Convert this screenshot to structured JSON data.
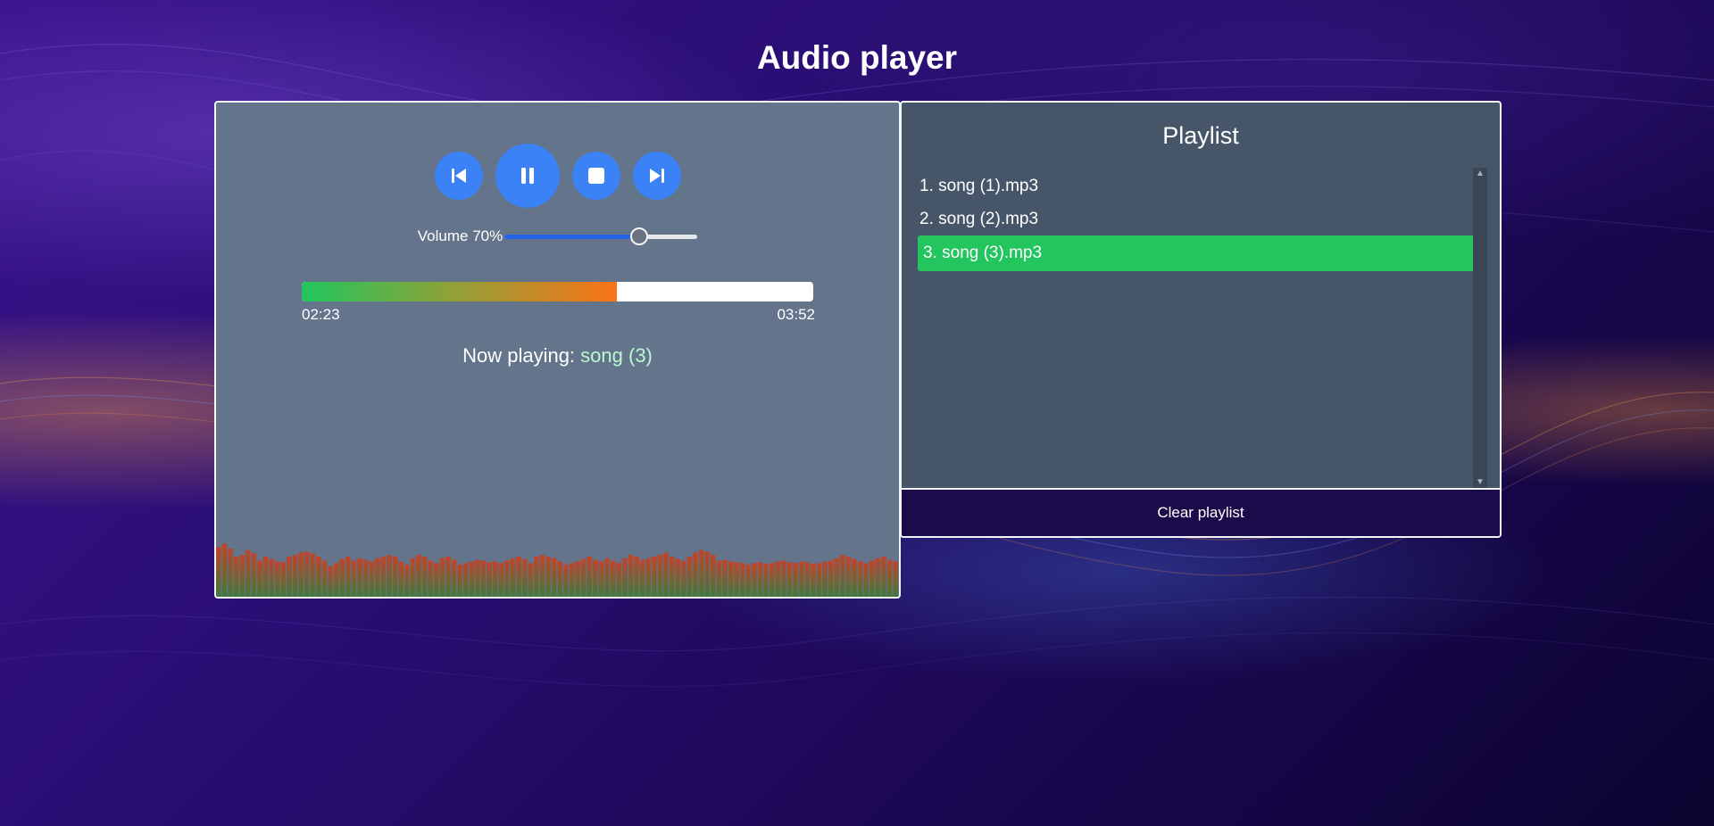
{
  "app": {
    "title": "Audio player"
  },
  "controls": {
    "previous_icon": "skip-previous-icon",
    "pause_icon": "pause-icon",
    "stop_icon": "stop-icon",
    "next_icon": "skip-next-icon",
    "accent_color": "#3b82f6"
  },
  "volume": {
    "label": "Volume 70%",
    "value": 70
  },
  "progress": {
    "current": "02:23",
    "duration": "03:52",
    "fraction": 0.616
  },
  "now_playing": {
    "prefix": "Now playing:",
    "song": "song (3)"
  },
  "visualizer": {
    "levels": [
      0.62,
      0.66,
      0.6,
      0.5,
      0.52,
      0.58,
      0.54,
      0.45,
      0.5,
      0.47,
      0.44,
      0.43,
      0.5,
      0.52,
      0.55,
      0.56,
      0.54,
      0.5,
      0.45,
      0.38,
      0.42,
      0.47,
      0.5,
      0.45,
      0.48,
      0.46,
      0.44,
      0.48,
      0.5,
      0.52,
      0.5,
      0.44,
      0.4,
      0.48,
      0.52,
      0.5,
      0.45,
      0.42,
      0.48,
      0.5,
      0.46,
      0.4,
      0.42,
      0.44,
      0.46,
      0.45,
      0.43,
      0.44,
      0.42,
      0.45,
      0.48,
      0.5,
      0.47,
      0.42,
      0.5,
      0.52,
      0.5,
      0.48,
      0.44,
      0.4,
      0.42,
      0.44,
      0.47,
      0.5,
      0.46,
      0.44,
      0.48,
      0.45,
      0.42,
      0.48,
      0.52,
      0.5,
      0.46,
      0.48,
      0.5,
      0.52,
      0.55,
      0.5,
      0.47,
      0.45,
      0.5,
      0.55,
      0.58,
      0.56,
      0.52,
      0.45,
      0.46,
      0.44,
      0.43,
      0.42,
      0.4,
      0.42,
      0.43,
      0.41,
      0.42,
      0.44,
      0.45,
      0.43,
      0.42,
      0.44,
      0.43,
      0.41,
      0.42,
      0.44,
      0.45,
      0.48,
      0.52,
      0.5,
      0.47,
      0.44,
      0.42,
      0.45,
      0.48,
      0.5,
      0.46,
      0.44
    ],
    "low_color": "#3f7a3a",
    "high_color": "#c0442a"
  },
  "playlist": {
    "title": "Playlist",
    "items": [
      {
        "label": "1. song (1).mp3"
      },
      {
        "label": "2. song (2).mp3"
      },
      {
        "label": "3. song (3).mp3"
      }
    ],
    "active_index": 2,
    "active_color": "#22c55e",
    "clear_label": "Clear playlist"
  }
}
